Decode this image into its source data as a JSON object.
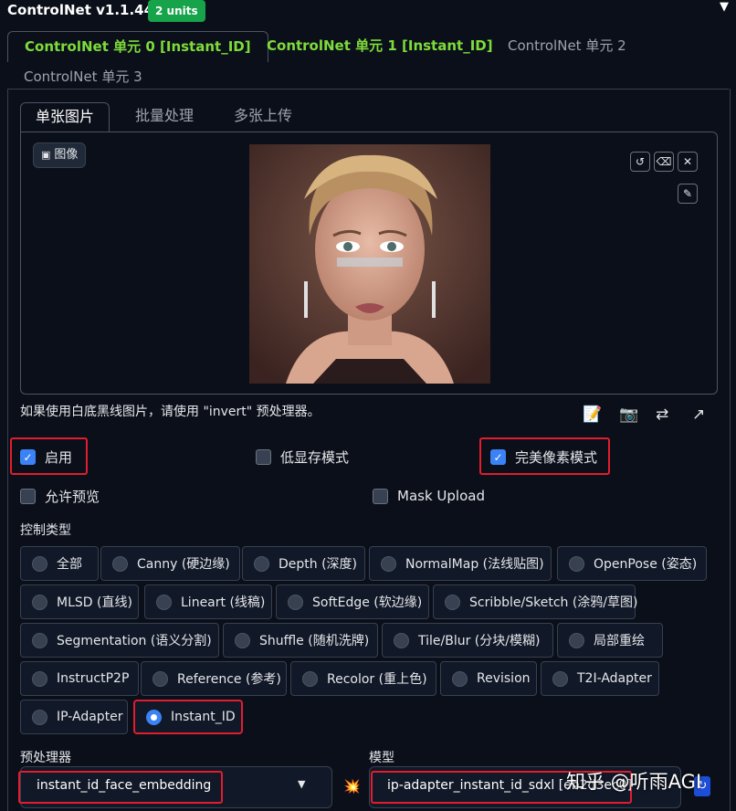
{
  "header": {
    "title": "ControlNet v1.1.440",
    "badge": "2 units",
    "collapse_glyph": "▼"
  },
  "unit_tabs": [
    {
      "label": "ControlNet 单元 0 [Instant_ID]"
    },
    {
      "label": "ControlNet 单元 1 [Instant_ID]"
    },
    {
      "label": "ControlNet 单元 2"
    },
    {
      "label": "ControlNet 单元 3"
    }
  ],
  "input_tabs": [
    {
      "label": "单张图片"
    },
    {
      "label": "批量处理"
    },
    {
      "label": "多张上传"
    }
  ],
  "image": {
    "label": "图像"
  },
  "hint": "如果使用白底黑线图片，请使用 \"invert\" 预处理器。",
  "checkboxes": {
    "enable": {
      "label": "启用",
      "checked": true
    },
    "low_vram": {
      "label": "低显存模式",
      "checked": false
    },
    "pixel_perfect": {
      "label": "完美像素模式",
      "checked": true
    },
    "allow_preview": {
      "label": "允许预览",
      "checked": false
    },
    "mask_upload": {
      "label": "Mask Upload",
      "checked": false
    }
  },
  "control_type": {
    "label": "控制类型",
    "options": [
      "全部",
      "Canny (硬边缘)",
      "Depth (深度)",
      "NormalMap (法线贴图)",
      "OpenPose (姿态)",
      "MLSD (直线)",
      "Lineart (线稿)",
      "SoftEdge (软边缘)",
      "Scribble/Sketch (涂鸦/草图)",
      "Segmentation (语义分割)",
      "Shuffle (随机洗牌)",
      "Tile/Blur (分块/模糊)",
      "局部重绘",
      "InstructP2P",
      "Reference (参考)",
      "Recolor (重上色)",
      "Revision",
      "T2I-Adapter",
      "IP-Adapter",
      "Instant_ID"
    ],
    "selected": "Instant_ID"
  },
  "preprocessor": {
    "label": "预处理器",
    "value": "instant_id_face_embedding"
  },
  "model": {
    "label": "模型",
    "value": "ip-adapter_instant_id_sdxl [eb2d3ec0]"
  },
  "watermark": "知乎 @听雨AGI"
}
